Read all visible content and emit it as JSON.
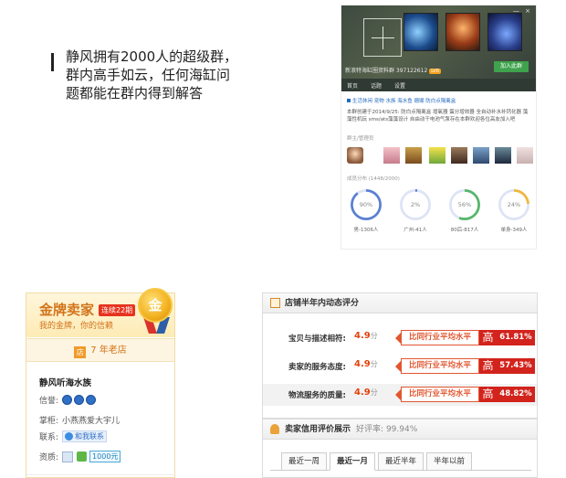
{
  "intro": {
    "text": "静风拥有2000人的超级群，群内高手如云，任何海缸问题都能在群内得到解答"
  },
  "qq_card": {
    "window_controls": "— ×",
    "group_name": "新浪特海缸圈资料群 397122612",
    "level": "LV6",
    "join_label": "加入此群",
    "tabs": [
      "首页",
      "话题",
      "设置"
    ],
    "tags": "生活休闲  宠物  水族  海水鱼  珊瑚  防白点隔离盒",
    "description": "本群创建于2014/9/25: 防白点隔离盒 增氧器 蛋分增效器 全自动补水补钙化器 藻藻性机玩 sms/ats藻藻设计 自由动干电池气泵存在本群欢迎各位高友加入吧",
    "admins_label": "群主/管理员",
    "members_label": "成员分布 (1448/2000)",
    "stats": [
      {
        "pct": "90%",
        "label": "男-1306人",
        "value": 0.9,
        "color": "#5b7fd3"
      },
      {
        "pct": "2%",
        "label": "广州-41人",
        "value": 0.02,
        "color": "#5b7fd3"
      },
      {
        "pct": "56%",
        "label": "80后-817人",
        "value": 0.56,
        "color": "#56b56a"
      },
      {
        "pct": "24%",
        "label": "单身-349人",
        "value": 0.24,
        "color": "#f0b63c"
      }
    ]
  },
  "seller": {
    "title": "金牌卖家",
    "streak": "连续22期",
    "slogan": "我的金牌，你的信赖",
    "medal_char": "金",
    "years_icon": "店",
    "years": "7 年老店",
    "shop_name": "静风听海水族",
    "reputation_label": "信誉:",
    "keeper_label": "掌柜:",
    "keeper": "小燕燕爱大宇儿",
    "contact_label": "联系:",
    "contact_btn": "和我联系",
    "qual_label": "资质:",
    "deposit": "1000元"
  },
  "ratings": {
    "header": "店铺半年内动态评分",
    "rows": [
      {
        "label": "宝贝与描述相符:",
        "score": "4.9",
        "unit": "分",
        "compare": "比同行业平均水平",
        "level": "高",
        "pct": "61.81%"
      },
      {
        "label": "卖家的服务态度:",
        "score": "4.9",
        "unit": "分",
        "compare": "比同行业平均水平",
        "level": "高",
        "pct": "57.43%"
      },
      {
        "label": "物流服务的质量:",
        "score": "4.9",
        "unit": "分",
        "compare": "比同行业平均水平",
        "level": "高",
        "pct": "48.82%"
      }
    ]
  },
  "credit": {
    "header": "卖家信用评价展示",
    "rate_label": "好评率:",
    "rate": "99.94%",
    "tabs": [
      "最近一周",
      "最近一月",
      "最近半年",
      "半年以前"
    ],
    "active_tab": 1
  }
}
